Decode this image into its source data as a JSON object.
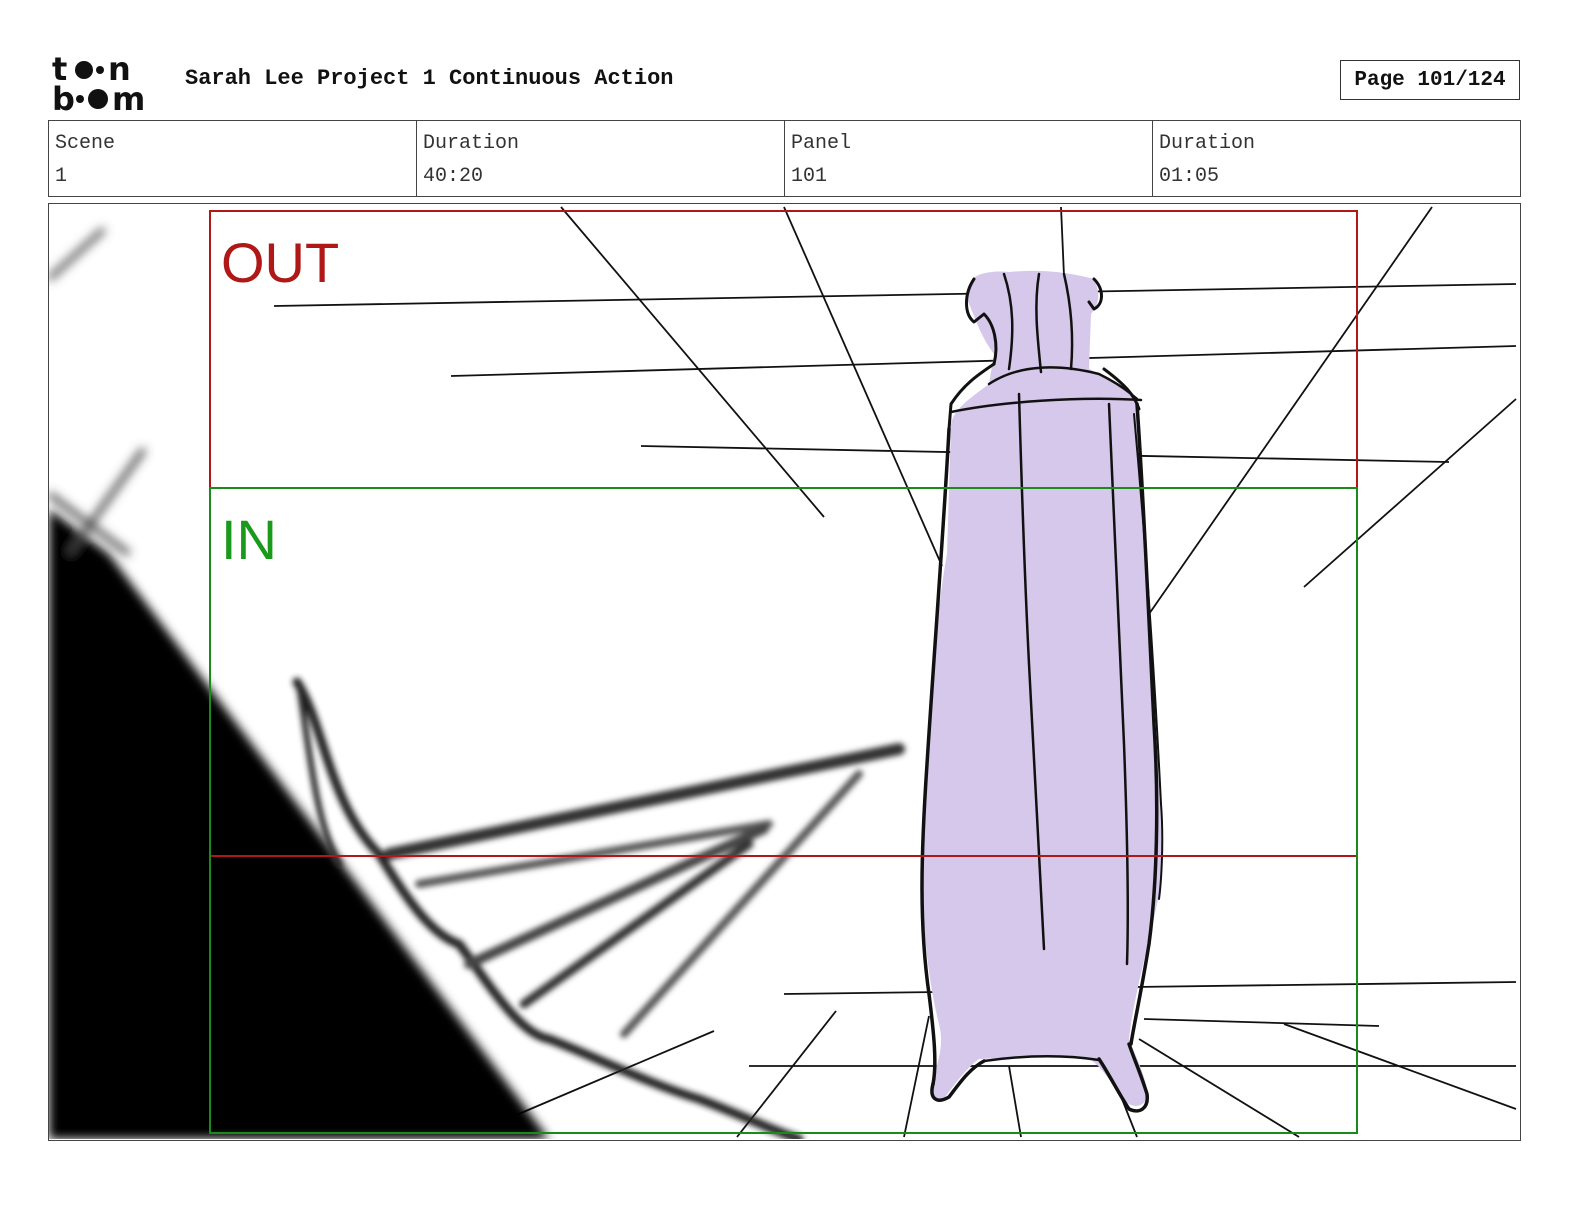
{
  "header": {
    "logo_text_top": "toon",
    "logo_text_bottom": "boom",
    "project_title": "Sarah Lee Project 1 Continuous Action",
    "page_label": "Page 101/124"
  },
  "info": {
    "scene_label": "Scene",
    "scene_value": "1",
    "scene_duration_label": "Duration",
    "scene_duration_value": "40:20",
    "panel_label": "Panel",
    "panel_value": "101",
    "panel_duration_label": "Duration",
    "panel_duration_value": "01:05"
  },
  "panel": {
    "out_label": "OUT",
    "in_label": "IN",
    "out_color": "#b01818",
    "in_color": "#1a9a1a",
    "figure_color": "#d6c8ea"
  }
}
